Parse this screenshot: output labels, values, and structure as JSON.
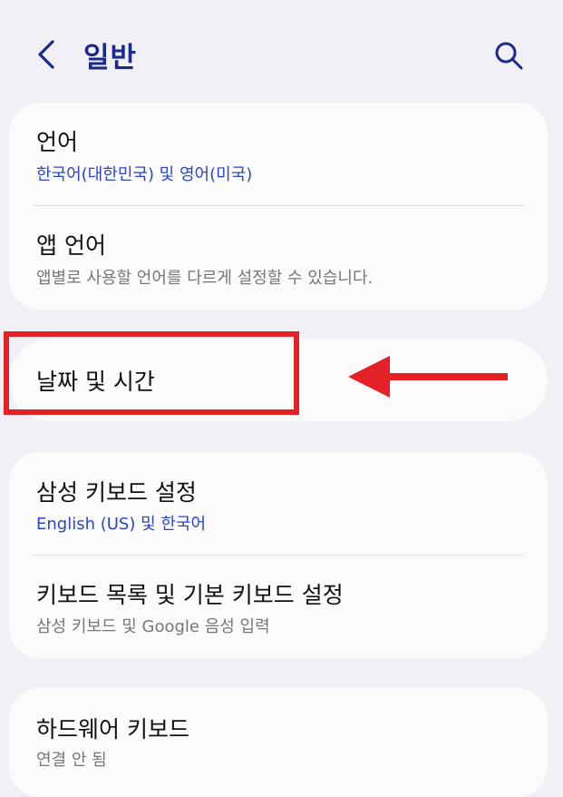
{
  "header": {
    "title": "일반",
    "back_icon": "chevron-left-icon",
    "search_icon": "search-icon"
  },
  "colors": {
    "title": "#1b2a8a",
    "accent_subtitle": "#2b46c8",
    "highlight": "#e52128",
    "background": "#f0f0f6",
    "card": "#fbfbfb"
  },
  "sections": {
    "language": {
      "title": "언어",
      "subtitle": "한국어(대한민국) 및 영어(미국)"
    },
    "app_language": {
      "title": "앱 언어",
      "subtitle": "앱별로 사용할 언어를 다르게 설정할 수 있습니다."
    },
    "date_time": {
      "title": "날짜 및 시간"
    },
    "samsung_keyboard": {
      "title": "삼성 키보드 설정",
      "subtitle": "English (US) 및 한국어"
    },
    "keyboard_list": {
      "title": "키보드 목록 및 기본 키보드 설정",
      "subtitle": "삼성 키보드 및 Google 음성 입력"
    },
    "hardware_keyboard": {
      "title": "하드웨어 키보드",
      "subtitle": "연결 안 됨"
    }
  },
  "annotation": {
    "highlight_target": "날짜 및 시간",
    "arrow_icon": "arrow-left-icon"
  }
}
